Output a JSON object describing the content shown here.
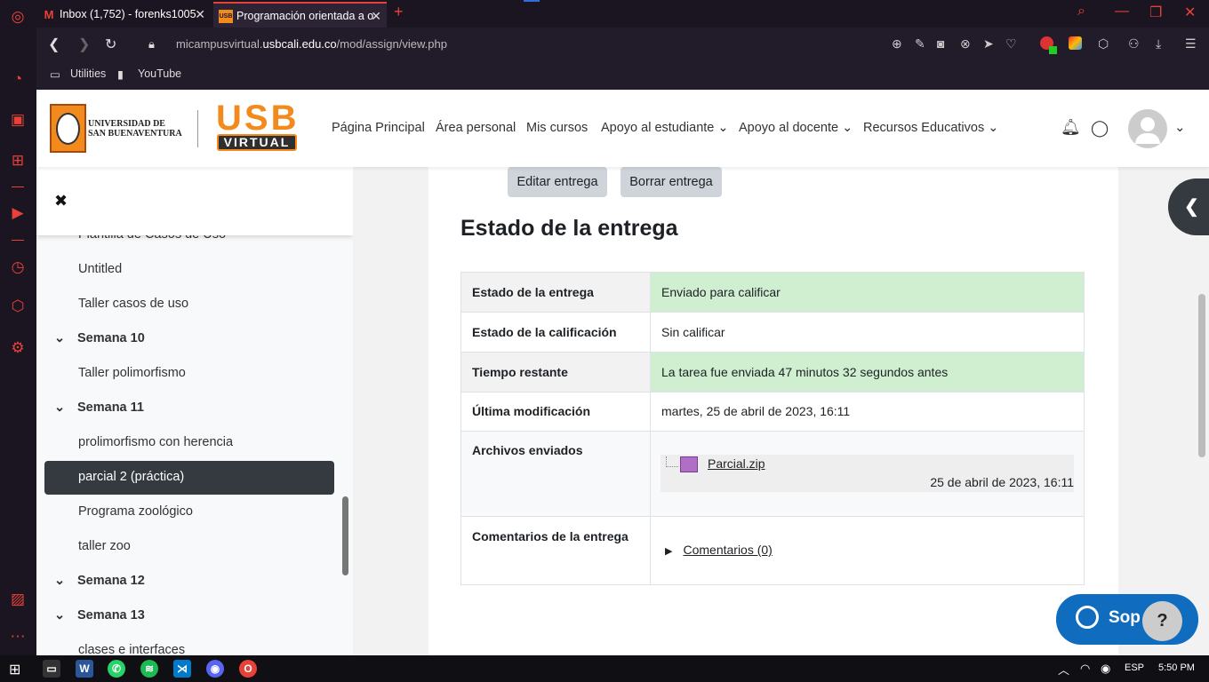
{
  "browser": {
    "tabs": [
      {
        "label": "Inbox (1,752) - forenks1005",
        "favicon": "M"
      },
      {
        "label": "Programación orientada a o",
        "favicon": "USB"
      }
    ],
    "url_prefix": "micampusvirtual.",
    "url_domain": "usbcali.edu.co",
    "url_path": "/mod/assign/view.php",
    "bookmarks": [
      "Utilities",
      "YouTube"
    ]
  },
  "site": {
    "logo_line1": "UNIVERSIDAD DE",
    "logo_line2": "SAN BUENAVENTURA",
    "brand_top": "USB",
    "brand_bottom": "VIRTUAL",
    "nav": [
      "Página Principal",
      "Área personal",
      "Mis cursos",
      "Apoyo al estudiante",
      "Apoyo al docente",
      "Recursos Educativos"
    ]
  },
  "drawer": {
    "close_icon": "✖",
    "items": [
      {
        "type": "item",
        "label": "Plantilla de Casos de Uso"
      },
      {
        "type": "item",
        "label": "Untitled"
      },
      {
        "type": "item",
        "label": "Taller casos de uso"
      },
      {
        "type": "section",
        "label": "Semana 10"
      },
      {
        "type": "item",
        "label": "Taller polimorfismo"
      },
      {
        "type": "section",
        "label": "Semana 11"
      },
      {
        "type": "item",
        "label": "prolimorfismo con herencia"
      },
      {
        "type": "item",
        "label": "parcial 2 (práctica)",
        "active": true
      },
      {
        "type": "item",
        "label": "Programa zoológico"
      },
      {
        "type": "item",
        "label": "taller zoo"
      },
      {
        "type": "section",
        "label": "Semana 12"
      },
      {
        "type": "section",
        "label": "Semana 13"
      },
      {
        "type": "item",
        "label": "clases e interfaces"
      }
    ]
  },
  "main": {
    "edit_button": "Editar entrega",
    "delete_button": "Borrar entrega",
    "section_title": "Estado de la entrega",
    "rows": [
      {
        "label": "Estado de la entrega",
        "value": "Enviado para calificar"
      },
      {
        "label": "Estado de la calificación",
        "value": "Sin calificar"
      },
      {
        "label": "Tiempo restante",
        "value": "La tarea fue enviada 47 minutos 32 segundos antes"
      },
      {
        "label": "Última modificación",
        "value": "martes, 25 de abril de 2023, 16:11"
      },
      {
        "label": "Archivos enviados",
        "file_name": "Parcial.zip",
        "file_date": "25 de abril de 2023, 16:11"
      },
      {
        "label": "Comentarios de la entrega",
        "comments_link": "Comentarios (0)"
      }
    ]
  },
  "support": {
    "label": "Sop",
    "help": "?"
  },
  "taskbar": {
    "lang": "ESP",
    "time": "5:50 PM"
  },
  "colors": {
    "accent_orange": "#f28a1e",
    "browser_red": "#e8413a",
    "success_bg": "#cfefd0",
    "dark_active": "#343a40",
    "support_blue": "#0f6cbf"
  }
}
